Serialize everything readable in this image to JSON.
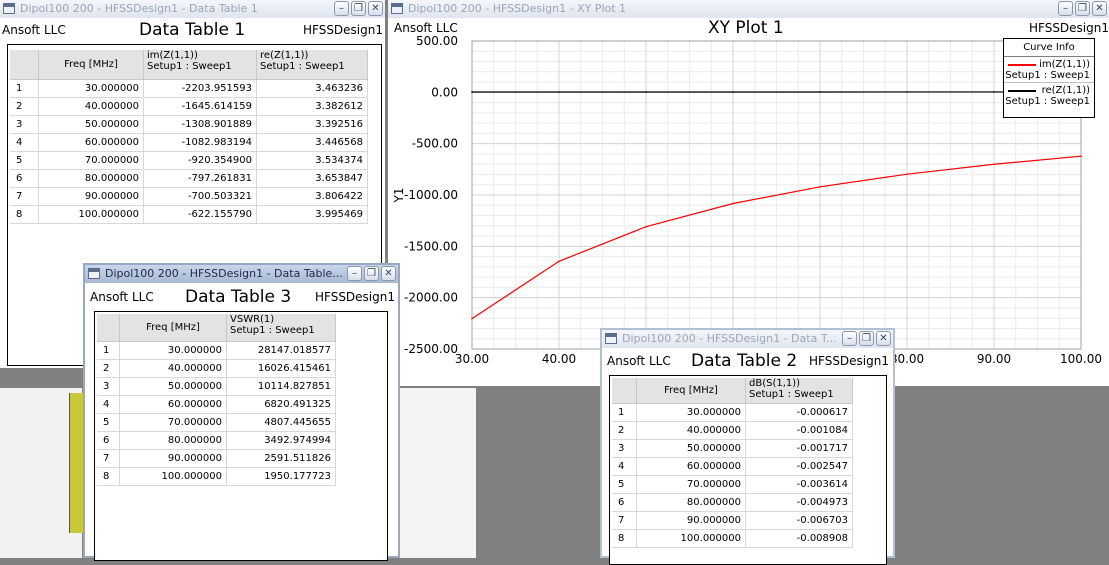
{
  "colors": {
    "curve_im": "#ff0000",
    "curve_re": "#000000",
    "grid": "#d4d4d4",
    "bg_workspace": "#808080"
  },
  "windows": {
    "table1": {
      "title": "Dipol100 200 - HFSSDesign1 - Data Table 1",
      "company": "Ansoft LLC",
      "design": "HFSSDesign1",
      "heading": "Data Table 1",
      "columns": [
        "Freq [MHz]",
        "im(Z(1,1))",
        "Setup1 : Sweep1",
        "re(Z(1,1))",
        "Setup1 : Sweep1"
      ],
      "rows": [
        [
          "1",
          "30.000000",
          "-2203.951593",
          "3.463236"
        ],
        [
          "2",
          "40.000000",
          "-1645.614159",
          "3.382612"
        ],
        [
          "3",
          "50.000000",
          "-1308.901889",
          "3.392516"
        ],
        [
          "4",
          "60.000000",
          "-1082.983194",
          "3.446568"
        ],
        [
          "5",
          "70.000000",
          "-920.354900",
          "3.534374"
        ],
        [
          "6",
          "80.000000",
          "-797.261831",
          "3.653847"
        ],
        [
          "7",
          "90.000000",
          "-700.503321",
          "3.806422"
        ],
        [
          "8",
          "100.000000",
          "-622.155790",
          "3.995469"
        ]
      ]
    },
    "plot": {
      "title": "Dipol100 200 - HFSSDesign1 - XY Plot 1",
      "company": "Ansoft LLC",
      "design": "HFSSDesign1",
      "heading": "XY Plot 1",
      "legend_title": "Curve Info",
      "legend": [
        {
          "name": "im(Z(1,1))",
          "setup": "Setup1 : Sweep1"
        },
        {
          "name": "re(Z(1,1))",
          "setup": "Setup1 : Sweep1"
        }
      ]
    },
    "table3": {
      "title": "Dipol100 200 - HFSSDesign1 - Data Table...",
      "company": "Ansoft LLC",
      "design": "HFSSDesign1",
      "heading": "Data Table 3",
      "columns": [
        "Freq [MHz]",
        "VSWR(1)",
        "Setup1 : Sweep1"
      ],
      "rows": [
        [
          "1",
          "30.000000",
          "28147.018577"
        ],
        [
          "2",
          "40.000000",
          "16026.415461"
        ],
        [
          "3",
          "50.000000",
          "10114.827851"
        ],
        [
          "4",
          "60.000000",
          "6820.491325"
        ],
        [
          "5",
          "70.000000",
          "4807.445655"
        ],
        [
          "6",
          "80.000000",
          "3492.974994"
        ],
        [
          "7",
          "90.000000",
          "2591.511826"
        ],
        [
          "8",
          "100.000000",
          "1950.177723"
        ]
      ]
    },
    "table2": {
      "title": "Dipol100 200 - HFSSDesign1 - Data T...",
      "company": "Ansoft LLC",
      "design": "HFSSDesign1",
      "heading": "Data Table 2",
      "columns": [
        "Freq [MHz]",
        "dB(S(1,1))",
        "Setup1 : Sweep1"
      ],
      "rows": [
        [
          "1",
          "30.000000",
          "-0.000617"
        ],
        [
          "2",
          "40.000000",
          "-0.001084"
        ],
        [
          "3",
          "50.000000",
          "-0.001717"
        ],
        [
          "4",
          "60.000000",
          "-0.002547"
        ],
        [
          "5",
          "70.000000",
          "-0.003614"
        ],
        [
          "6",
          "80.000000",
          "-0.004973"
        ],
        [
          "7",
          "90.000000",
          "-0.006703"
        ],
        [
          "8",
          "100.000000",
          "-0.008908"
        ]
      ]
    }
  },
  "chart_data": {
    "type": "line",
    "title": "XY Plot 1",
    "xlabel": "",
    "ylabel": "Y1",
    "xlim": [
      30,
      100
    ],
    "ylim": [
      -2500,
      500
    ],
    "x_ticks": [
      "30.00",
      "40.00",
      "50.00",
      "60.00",
      "70.00",
      "80.00",
      "90.00",
      "100.00"
    ],
    "y_ticks": [
      "500.00",
      "0.00",
      "-500.00",
      "-1000.00",
      "-1500.00",
      "-2000.00",
      "-2500.00"
    ],
    "grid": true,
    "legend_position": "top-right",
    "x": [
      30,
      40,
      50,
      60,
      70,
      80,
      90,
      100
    ],
    "series": [
      {
        "name": "im(Z(1,1))",
        "values": [
          -2203.951593,
          -1645.614159,
          -1308.901889,
          -1082.983194,
          -920.3549,
          -797.261831,
          -700.503321,
          -622.15579
        ]
      },
      {
        "name": "re(Z(1,1))",
        "values": [
          3.463236,
          3.382612,
          3.392516,
          3.446568,
          3.534374,
          3.653847,
          3.806422,
          3.995469
        ]
      }
    ]
  }
}
